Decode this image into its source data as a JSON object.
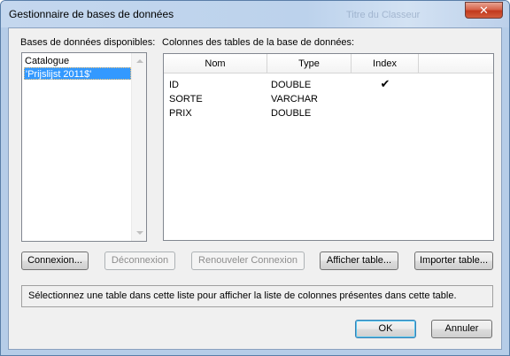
{
  "window": {
    "title": "Gestionnaire de bases de données",
    "background_title": "Titre du Classeur",
    "close_glyph": "✕"
  },
  "databases": {
    "label": "Bases de données disponibles:",
    "items": [
      {
        "label": "Catalogue",
        "selected": false
      },
      {
        "label": "'Prijslijst 2011$'",
        "selected": true
      }
    ]
  },
  "columns": {
    "label": "Colonnes des tables de la base de données:",
    "headers": [
      "Nom",
      "Type",
      "Index"
    ],
    "rows": [
      {
        "name": "ID",
        "type": "DOUBLE",
        "index": "✔"
      },
      {
        "name": "SORTE",
        "type": "VARCHAR",
        "index": ""
      },
      {
        "name": "PRIX",
        "type": "DOUBLE",
        "index": ""
      }
    ]
  },
  "buttons": {
    "connect": "Connexion...",
    "disconnect": "Déconnexion",
    "reconnect": "Renouveler Connexion",
    "show_table": "Afficher table...",
    "import_table": "Importer table...",
    "ok": "OK",
    "cancel": "Annuler"
  },
  "status": {
    "text": "Sélectionnez une table dans cette liste pour afficher la liste de colonnes présentes dans cette table."
  },
  "colors": {
    "selection": "#3399ff",
    "close_button": "#c2391e",
    "titlebar": "#bcd2ec"
  }
}
